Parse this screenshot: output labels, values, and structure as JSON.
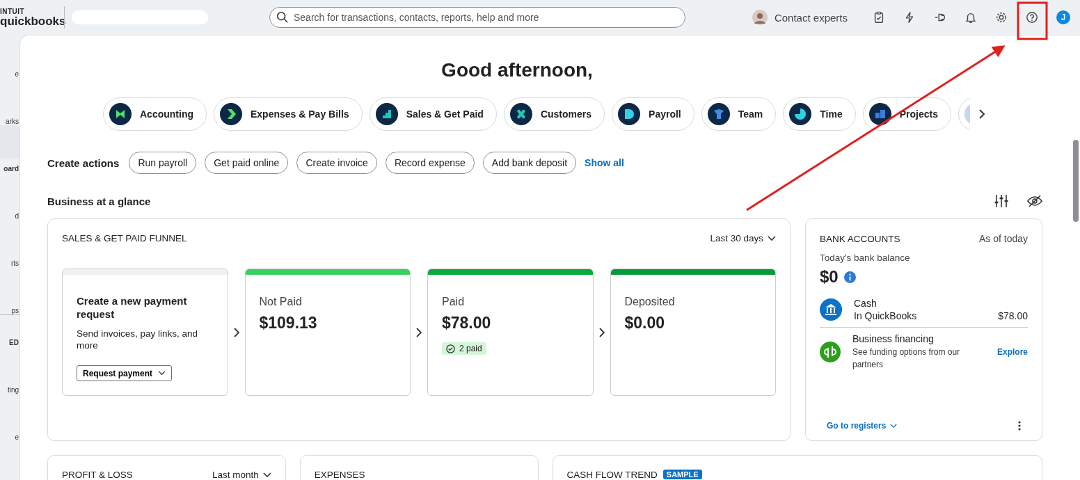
{
  "top_bar": {
    "logo": {
      "line1": "INTUIT",
      "line2": "quickbooks"
    },
    "search": {
      "placeholder": "Search for transactions, contacts, reports, help and more"
    },
    "contact_experts": "Contact experts",
    "user_initial": "J"
  },
  "sidebar": {
    "items": [
      {
        "label": "e",
        "selected": false
      },
      {
        "label": "arks",
        "selected": false
      },
      {
        "label": "oard",
        "selected": true
      },
      {
        "label": "d",
        "selected": false
      },
      {
        "label": "rts",
        "selected": false
      },
      {
        "label": "ps",
        "selected": false
      },
      {
        "label": "ED",
        "selected": false,
        "kind": "heading"
      },
      {
        "label": "ting",
        "selected": false
      },
      {
        "label": "e",
        "selected": false
      }
    ]
  },
  "greeting": "Good afternoon,",
  "nav_pills": [
    {
      "label": "Accounting",
      "kind": "accounting"
    },
    {
      "label": "Expenses & Pay Bills",
      "kind": "expenses"
    },
    {
      "label": "Sales & Get Paid",
      "kind": "sales"
    },
    {
      "label": "Customers",
      "kind": "customers"
    },
    {
      "label": "Payroll",
      "kind": "payroll"
    },
    {
      "label": "Team",
      "kind": "team"
    },
    {
      "label": "Time",
      "kind": "time"
    },
    {
      "label": "Projects",
      "kind": "projects"
    },
    {
      "kind": "more"
    }
  ],
  "create_actions": {
    "label": "Create actions",
    "actions": [
      "Run payroll",
      "Get paid online",
      "Create invoice",
      "Record expense",
      "Add bank deposit"
    ],
    "show_all": "Show all"
  },
  "business_at_a_glance": {
    "title": "Business at a glance"
  },
  "funnel": {
    "title": "SALES & GET PAID FUNNEL",
    "period": "Last 30 days",
    "stages": [
      {
        "kind": "action",
        "title": "Create a new payment request",
        "text": "Send invoices, pay links, and more",
        "button": "Request payment"
      },
      {
        "kind": "stage",
        "label": "Not Paid",
        "amount": "$109.13",
        "color": "#39d05b"
      },
      {
        "kind": "stage",
        "label": "Paid",
        "amount": "$78.00",
        "color": "#0aaa3c",
        "badge": "2 paid"
      },
      {
        "kind": "stage",
        "label": "Deposited",
        "amount": "$0.00",
        "color": "#079a38"
      }
    ]
  },
  "bank_accounts": {
    "title": "BANK ACCOUNTS",
    "as_of": "As of today",
    "balance_label": "Today's bank balance",
    "balance": "$0",
    "accounts": [
      {
        "kind": "bank",
        "name": "Cash",
        "sub": "In QuickBooks",
        "amount": "$78.00"
      },
      {
        "kind": "financing",
        "name": "Business financing",
        "sub": "See funding options from our partners",
        "link": "Explore"
      }
    ],
    "footer_link": "Go to registers"
  },
  "bottom_cards": [
    {
      "title": "PROFIT & LOSS",
      "period": "Last month"
    },
    {
      "title": "EXPENSES"
    },
    {
      "title": "CASH FLOW TREND",
      "badge": "SAMPLE"
    }
  ]
}
